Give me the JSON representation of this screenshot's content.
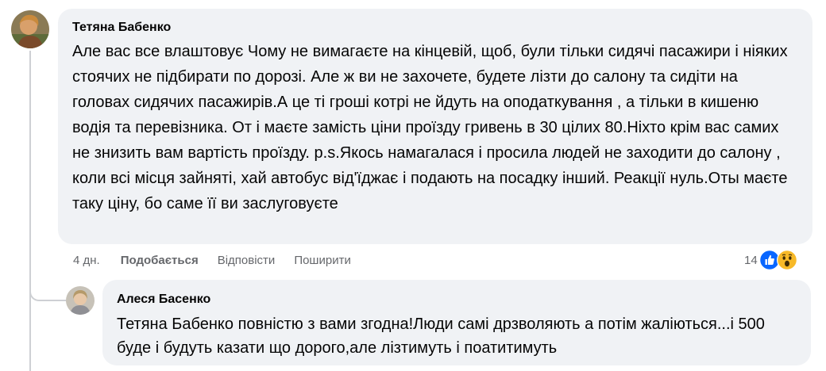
{
  "comment": {
    "author": "Тетяна Бабенко",
    "text": "Але вас все влаштовує Чому не вимагаєте на кінцевій, щоб, були тільки сидячі пасажири і ніяких стоячих не підбирати по дорозі. Але ж ви не захочете, будете лізти до салону та сидіти на головах сидячих пасажирів.А це ті гроші котрі не йдуть на оподаткування , а тільки в кишеню водія та перевізника. От і маєте замість ціни проїзду гривень в 30 цілих 80.Ніхто крім вас самих не знизить вам вартість проїзду. p.s.Якось намагалася і просила людей не заходити до салону , коли всі місця зайняті, хай автобус від'їджає і подають на посадку інший. Реакції нуль.Оты маєте таку ціну, бо саме її ви заслуговуєте",
    "time": "4 дн.",
    "like_label": "Подобається",
    "reply_label": "Відповісти",
    "share_label": "Поширити",
    "reaction_count": "14",
    "reactions": [
      "like-icon",
      "wow-icon"
    ]
  },
  "reply": {
    "author": "Алеся Басенко",
    "text": "Тетяна Бабенко повністю з вами згодна!Люди самі дрзволяють а потім жаліються...і 500 буде і будуть казати що дорого,але лізтимуть і поатитимуть"
  },
  "colors": {
    "bubble": "#f0f2f5",
    "meta_text": "#65676b",
    "like_blue": "#0866ff",
    "wow_yellow": "#f7b928"
  }
}
